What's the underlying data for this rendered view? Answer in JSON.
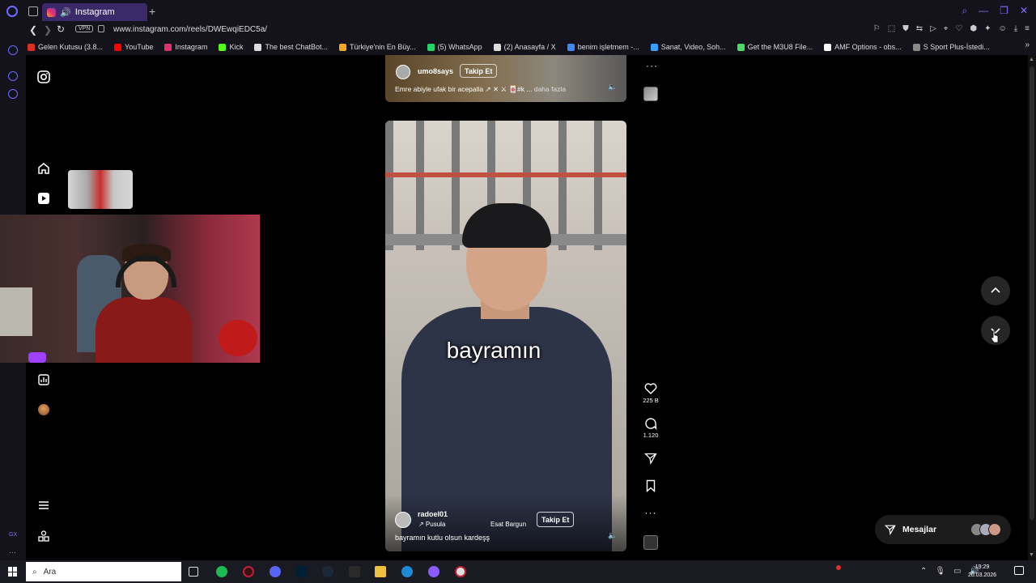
{
  "browser": {
    "tab_title": "Instagram",
    "url": "www.instagram.com/reels/DWEwqiEDC5a/",
    "vpn_label": "VPN",
    "bookmarks": [
      {
        "label": "Gelen Kutusu (3.8...",
        "color": "#d93025"
      },
      {
        "label": "YouTube",
        "color": "#ff0000"
      },
      {
        "label": "Instagram",
        "color": "#e1306c"
      },
      {
        "label": "Kick",
        "color": "#53fc18"
      },
      {
        "label": "The best ChatBot...",
        "color": "#dddddd"
      },
      {
        "label": "Türkiye'nin En Büy...",
        "color": "#f5a623"
      },
      {
        "label": "(5) WhatsApp",
        "color": "#25d366"
      },
      {
        "label": "(2) Anasayfa / X",
        "color": "#dddddd"
      },
      {
        "label": "benim işletmem -...",
        "color": "#4285f4"
      },
      {
        "label": "Sanat, Video, Soh...",
        "color": "#3aa0ff"
      },
      {
        "label": "Get the M3U8 File...",
        "color": "#4cd964"
      },
      {
        "label": "AMF Options - obs...",
        "color": "#ffffff"
      },
      {
        "label": "S Sport Plus-İstedi...",
        "color": "#888888"
      }
    ]
  },
  "reel_top": {
    "username": "umo8says",
    "follow_label": "Takip Et",
    "caption": "Emre abiyle ufak bir acepalla ↗ ✕ ⚔ 🀄#k ...",
    "caption_more": "daha fazla"
  },
  "reel_main": {
    "overlay_text": "bayramın",
    "username": "radoel01",
    "audio_label": "↗ Pusula",
    "audio_artist": "Esat Bargun",
    "follow_label": "Takip Et",
    "caption": "bayramın kutlu olsun kardeşş"
  },
  "actions": {
    "likes": "225 B",
    "comments": "1.120"
  },
  "messages": {
    "label": "Mesajlar"
  },
  "taskbar": {
    "search_placeholder": "Ara",
    "time": "19:29",
    "date": "20.03.2026"
  },
  "colors": {
    "background": "#000000",
    "chrome": "#14121a",
    "accent": "#6a6cff"
  }
}
